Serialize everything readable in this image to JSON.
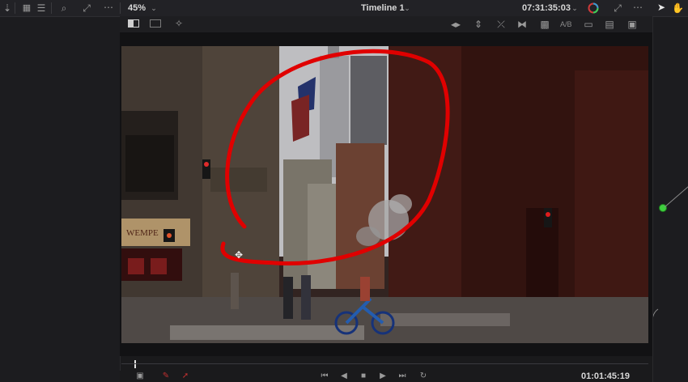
{
  "zoom": "45%",
  "timeline": {
    "name": "Timeline 1"
  },
  "timecode_top": "07:31:35:03",
  "timecode_bottom": "01:01:45:19",
  "view_toggles": [
    "A/B"
  ],
  "video": {
    "storefront_text": "WEMPE"
  },
  "colors": {
    "annotation": "#e00000",
    "node_green": "#3ecf3e",
    "bg": "#1a1a1c"
  },
  "icons": {
    "toolbar": [
      "download-icon",
      "grid-icon",
      "list-icon",
      "search-icon",
      "expand-icon",
      "more-icon"
    ],
    "viewer_tools": [
      "wipe-icon",
      "split-icon",
      "flip-icon",
      "mirror-icon",
      "compare-icon",
      "fullscreen-icon"
    ],
    "transport": [
      "jump-start-icon",
      "step-back-icon",
      "stop-icon",
      "play-icon",
      "step-forward-icon",
      "jump-end-icon",
      "loop-icon"
    ]
  }
}
